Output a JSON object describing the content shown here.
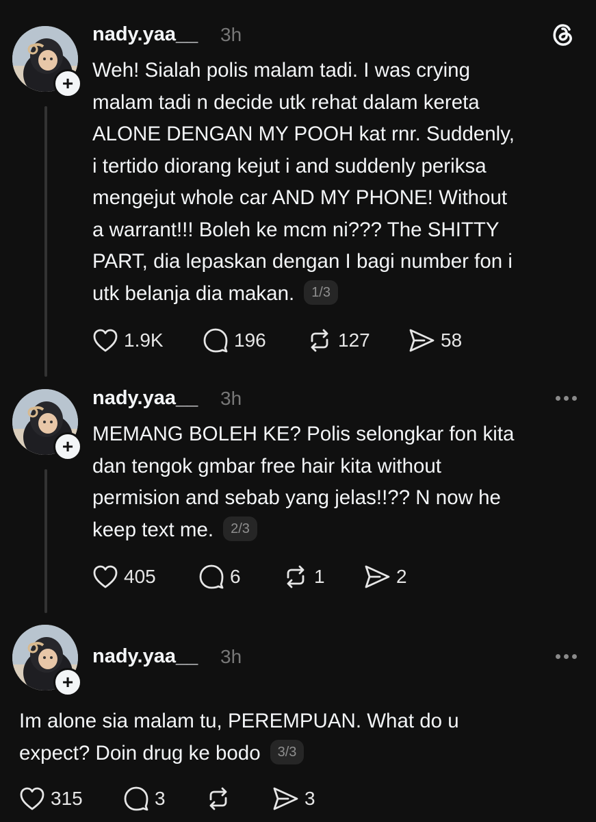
{
  "app": {
    "logo_icon": "threads-logo-icon"
  },
  "posts": [
    {
      "username": "nady.yaa__",
      "time": "3h",
      "text": "Weh! Sialah polis malam tadi. I was crying\nmalam tadi n decide utk rehat dalam kereta\nALONE DENGAN MY POOH kat rnr. Suddenly,\ni tertido diorang kejut i and suddenly periksa\nmengejut whole car AND MY PHONE! Without\na warrant!!! Boleh ke mcm ni??? The SHITTY\nPART, dia lepaskan dengan I bagi number fon i\nutk belanja dia makan.",
      "counter": "1/3",
      "likes": "1.9K",
      "replies": "196",
      "reposts": "127",
      "shares": "58"
    },
    {
      "username": "nady.yaa__",
      "time": "3h",
      "text": "MEMANG BOLEH KE? Polis selongkar fon kita\ndan tengok gmbar free hair kita without\npermision and sebab yang jelas!!?? N now he\nkeep text me.",
      "counter": "2/3",
      "likes": "405",
      "replies": "6",
      "reposts": "1",
      "shares": "2"
    },
    {
      "username": "nady.yaa__",
      "time": "3h",
      "text": "Im alone sia malam tu, PEREMPUAN. What do u\nexpect? Doin drug ke bodo",
      "counter": "3/3",
      "likes": "315",
      "replies": "3",
      "reposts": "",
      "shares": "3"
    }
  ],
  "colors": {
    "background": "#101010",
    "text": "#f3f5f7",
    "muted": "#777777",
    "thread_line": "#333333"
  }
}
